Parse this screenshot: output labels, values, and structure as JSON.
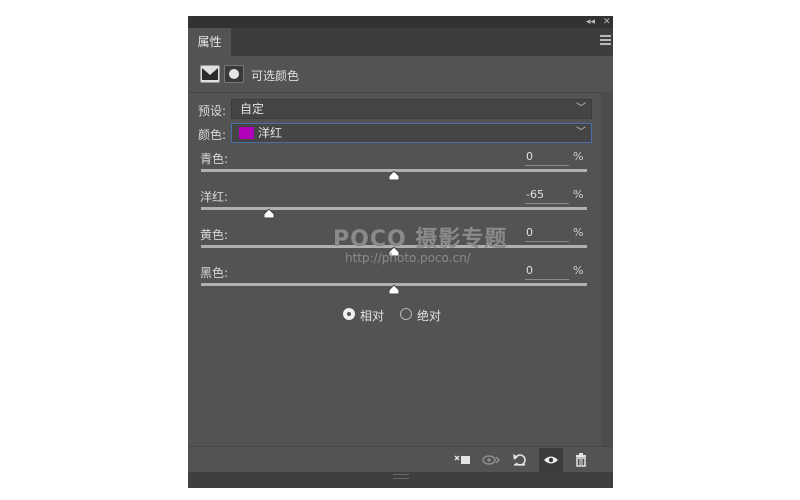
{
  "panel": {
    "tab_label": "属性",
    "adjustment_title": "可选颜色"
  },
  "preset": {
    "label": "预设:",
    "value": "自定"
  },
  "colors": {
    "label": "颜色:",
    "value": "洋红",
    "swatch_color": "#b000b8"
  },
  "sliders": [
    {
      "label": "青色:",
      "value": "0",
      "unit": "%",
      "level": 0.5
    },
    {
      "label": "洋红:",
      "value": "-65",
      "unit": "%",
      "level": 0.175
    },
    {
      "label": "黄色:",
      "value": "0",
      "unit": "%",
      "level": 0.5
    },
    {
      "label": "黑色:",
      "value": "0",
      "unit": "%",
      "level": 0.5
    }
  ],
  "method": {
    "options": [
      {
        "label": "相对",
        "selected": true
      },
      {
        "label": "绝对",
        "selected": false
      }
    ]
  },
  "watermark": {
    "brand": "POCO 摄影专题",
    "url": "http://photo.poco.cn/"
  },
  "footer": {
    "buttons": [
      "clip-to-layer-icon",
      "view-previous-state-icon",
      "reset-icon",
      "visibility-icon",
      "trash-icon"
    ]
  }
}
